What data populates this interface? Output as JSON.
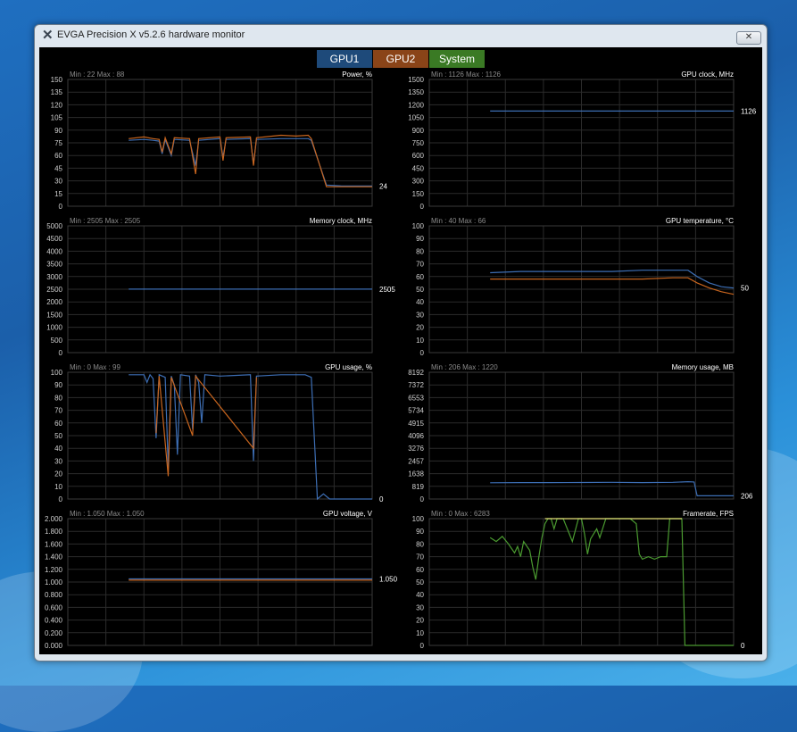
{
  "window": {
    "title": "EVGA Precision X v5.2.6 hardware monitor",
    "close_label": "✕"
  },
  "tabs": [
    {
      "label": "GPU1",
      "color": "#1e4a7a"
    },
    {
      "label": "GPU2",
      "color": "#8a4418"
    },
    {
      "label": "System",
      "color": "#3a7a24"
    }
  ],
  "colors": {
    "gpu1_line": "#3d6eb4",
    "gpu2_line": "#c8651e",
    "system_line": "#e6e07a",
    "system_line_low": "#4a9a30",
    "grid": "#2b2b2b"
  },
  "chart_data": [
    {
      "type": "line",
      "title": "Power, %",
      "minmax": "Min : 22   Max : 88",
      "yticks": [
        "150",
        "135",
        "120",
        "105",
        "90",
        "75",
        "60",
        "45",
        "30",
        "15",
        "0"
      ],
      "ylim": [
        0,
        150
      ],
      "current": "24",
      "series": [
        {
          "color": "#3d6eb4",
          "points": [
            [
              0.2,
              78
            ],
            [
              0.25,
              79
            ],
            [
              0.28,
              78
            ],
            [
              0.3,
              77
            ],
            [
              0.31,
              62
            ],
            [
              0.32,
              79
            ],
            [
              0.34,
              60
            ],
            [
              0.35,
              79
            ],
            [
              0.4,
              78
            ],
            [
              0.42,
              48
            ],
            [
              0.43,
              78
            ],
            [
              0.5,
              80
            ],
            [
              0.51,
              58
            ],
            [
              0.52,
              79
            ],
            [
              0.6,
              80
            ],
            [
              0.61,
              50
            ],
            [
              0.62,
              79
            ],
            [
              0.7,
              80
            ],
            [
              0.75,
              80
            ],
            [
              0.79,
              80
            ],
            [
              0.8,
              78
            ],
            [
              0.85,
              25
            ],
            [
              0.9,
              24
            ],
            [
              1.0,
              24
            ]
          ]
        },
        {
          "color": "#c8651e",
          "points": [
            [
              0.2,
              80
            ],
            [
              0.25,
              82
            ],
            [
              0.28,
              80
            ],
            [
              0.3,
              79
            ],
            [
              0.31,
              64
            ],
            [
              0.32,
              81
            ],
            [
              0.34,
              62
            ],
            [
              0.35,
              81
            ],
            [
              0.4,
              80
            ],
            [
              0.42,
              38
            ],
            [
              0.43,
              80
            ],
            [
              0.5,
              82
            ],
            [
              0.51,
              54
            ],
            [
              0.52,
              81
            ],
            [
              0.6,
              82
            ],
            [
              0.61,
              48
            ],
            [
              0.62,
              81
            ],
            [
              0.7,
              84
            ],
            [
              0.75,
              83
            ],
            [
              0.79,
              84
            ],
            [
              0.8,
              80
            ],
            [
              0.85,
              23
            ],
            [
              0.9,
              23
            ],
            [
              1.0,
              23
            ]
          ]
        }
      ]
    },
    {
      "type": "line",
      "title": "GPU clock, MHz",
      "minmax": "Min : 1126   Max : 1126",
      "yticks": [
        "1500",
        "1350",
        "1200",
        "1050",
        "900",
        "750",
        "600",
        "450",
        "300",
        "150",
        "0"
      ],
      "ylim": [
        0,
        1500
      ],
      "current": "1126",
      "series": [
        {
          "color": "#3d6eb4",
          "points": [
            [
              0.2,
              1126
            ],
            [
              1.0,
              1126
            ]
          ]
        }
      ]
    },
    {
      "type": "line",
      "title": "Memory clock, MHz",
      "minmax": "Min : 2505   Max : 2505",
      "yticks": [
        "5000",
        "4500",
        "4000",
        "3500",
        "3000",
        "2500",
        "2000",
        "1500",
        "1000",
        "500",
        "0"
      ],
      "ylim": [
        0,
        5000
      ],
      "current": "2505",
      "series": [
        {
          "color": "#3d6eb4",
          "points": [
            [
              0.2,
              2505
            ],
            [
              1.0,
              2505
            ]
          ]
        }
      ]
    },
    {
      "type": "line",
      "title": "GPU temperature, °C",
      "minmax": "Min : 40   Max : 66",
      "yticks": [
        "100",
        "90",
        "80",
        "70",
        "60",
        "50",
        "40",
        "30",
        "20",
        "10",
        "0"
      ],
      "ylim": [
        0,
        100
      ],
      "current": "50",
      "series": [
        {
          "color": "#3d6eb4",
          "points": [
            [
              0.2,
              63
            ],
            [
              0.3,
              64
            ],
            [
              0.4,
              64
            ],
            [
              0.5,
              64
            ],
            [
              0.6,
              64
            ],
            [
              0.7,
              65
            ],
            [
              0.8,
              65
            ],
            [
              0.85,
              65
            ],
            [
              0.88,
              60
            ],
            [
              0.92,
              55
            ],
            [
              0.96,
              52
            ],
            [
              1.0,
              51
            ]
          ]
        },
        {
          "color": "#c8651e",
          "points": [
            [
              0.2,
              58
            ],
            [
              0.3,
              58
            ],
            [
              0.4,
              58
            ],
            [
              0.5,
              58
            ],
            [
              0.6,
              58
            ],
            [
              0.7,
              58
            ],
            [
              0.8,
              59
            ],
            [
              0.85,
              59
            ],
            [
              0.88,
              55
            ],
            [
              0.92,
              51
            ],
            [
              0.96,
              48
            ],
            [
              1.0,
              46
            ]
          ]
        }
      ]
    },
    {
      "type": "line",
      "title": "GPU usage, %",
      "minmax": "Min : 0   Max : 99",
      "yticks": [
        "100",
        "90",
        "80",
        "70",
        "60",
        "50",
        "40",
        "30",
        "20",
        "10",
        "0"
      ],
      "ylim": [
        0,
        100
      ],
      "current": "0",
      "series": [
        {
          "color": "#3d6eb4",
          "points": [
            [
              0.2,
              98
            ],
            [
              0.25,
              98
            ],
            [
              0.26,
              92
            ],
            [
              0.27,
              98
            ],
            [
              0.28,
              95
            ],
            [
              0.29,
              48
            ],
            [
              0.3,
              98
            ],
            [
              0.32,
              96
            ],
            [
              0.33,
              25
            ],
            [
              0.34,
              97
            ],
            [
              0.35,
              90
            ],
            [
              0.36,
              35
            ],
            [
              0.37,
              98
            ],
            [
              0.4,
              97
            ],
            [
              0.41,
              55
            ],
            [
              0.42,
              98
            ],
            [
              0.43,
              92
            ],
            [
              0.44,
              60
            ],
            [
              0.45,
              98
            ],
            [
              0.5,
              97
            ],
            [
              0.6,
              98
            ],
            [
              0.61,
              30
            ],
            [
              0.62,
              97
            ],
            [
              0.7,
              98
            ],
            [
              0.78,
              98
            ],
            [
              0.8,
              96
            ],
            [
              0.82,
              0
            ],
            [
              0.84,
              4
            ],
            [
              0.86,
              0
            ],
            [
              1.0,
              0
            ]
          ]
        },
        {
          "color": "#c8651e",
          "points": [
            [
              0.29,
              52
            ],
            [
              0.3,
              97
            ],
            [
              0.33,
              18
            ],
            [
              0.34,
              96
            ],
            [
              0.41,
              50
            ],
            [
              0.42,
              97
            ],
            [
              0.61,
              40
            ],
            [
              0.62,
              96
            ]
          ]
        }
      ]
    },
    {
      "type": "line",
      "title": "Memory usage, MB",
      "minmax": "Min : 206   Max : 1220",
      "yticks": [
        "8192",
        "7372",
        "6553",
        "5734",
        "4915",
        "4096",
        "3276",
        "2457",
        "1638",
        "819",
        "0"
      ],
      "ylim": [
        0,
        8192
      ],
      "current": "206",
      "series": [
        {
          "color": "#3d6eb4",
          "points": [
            [
              0.2,
              1050
            ],
            [
              0.3,
              1060
            ],
            [
              0.4,
              1060
            ],
            [
              0.5,
              1070
            ],
            [
              0.6,
              1080
            ],
            [
              0.7,
              1060
            ],
            [
              0.8,
              1080
            ],
            [
              0.85,
              1120
            ],
            [
              0.87,
              1100
            ],
            [
              0.88,
              206
            ],
            [
              1.0,
              206
            ]
          ]
        }
      ]
    },
    {
      "type": "line",
      "title": "GPU voltage, V",
      "minmax": "Min : 1.050   Max : 1.050",
      "yticks": [
        "2.000",
        "1.800",
        "1.600",
        "1.400",
        "1.200",
        "1.000",
        "0.800",
        "0.600",
        "0.400",
        "0.200",
        "0.000"
      ],
      "ylim": [
        0,
        2
      ],
      "current": "1.050",
      "series": [
        {
          "color": "#3d6eb4",
          "points": [
            [
              0.2,
              1.05
            ],
            [
              1.0,
              1.05
            ]
          ]
        },
        {
          "color": "#c8651e",
          "points": [
            [
              0.2,
              1.03
            ],
            [
              1.0,
              1.03
            ]
          ]
        }
      ]
    },
    {
      "type": "line",
      "title": "Framerate, FPS",
      "minmax": "Min : 0   Max : 6283",
      "yticks": [
        "100",
        "90",
        "80",
        "70",
        "60",
        "50",
        "40",
        "30",
        "20",
        "10",
        "0"
      ],
      "ylim": [
        0,
        100
      ],
      "current": "0",
      "series": [
        {
          "color": "#4a9a30",
          "points": [
            [
              0.2,
              85
            ],
            [
              0.22,
              82
            ],
            [
              0.24,
              86
            ],
            [
              0.26,
              80
            ],
            [
              0.28,
              73
            ],
            [
              0.29,
              78
            ],
            [
              0.3,
              70
            ],
            [
              0.31,
              82
            ],
            [
              0.33,
              75
            ],
            [
              0.34,
              62
            ],
            [
              0.35,
              52
            ],
            [
              0.36,
              70
            ],
            [
              0.37,
              85
            ],
            [
              0.38,
              96
            ],
            [
              0.39,
              100
            ],
            [
              0.4,
              100
            ],
            [
              0.41,
              92
            ],
            [
              0.42,
              100
            ],
            [
              0.44,
              100
            ],
            [
              0.46,
              88
            ],
            [
              0.47,
              82
            ],
            [
              0.49,
              100
            ],
            [
              0.5,
              100
            ],
            [
              0.51,
              88
            ],
            [
              0.52,
              72
            ],
            [
              0.53,
              84
            ],
            [
              0.55,
              92
            ],
            [
              0.56,
              85
            ],
            [
              0.58,
              100
            ],
            [
              0.6,
              100
            ],
            [
              0.62,
              100
            ],
            [
              0.64,
              100
            ],
            [
              0.66,
              100
            ],
            [
              0.68,
              96
            ],
            [
              0.69,
              72
            ],
            [
              0.7,
              68
            ],
            [
              0.72,
              70
            ],
            [
              0.74,
              68
            ],
            [
              0.76,
              70
            ],
            [
              0.78,
              70
            ],
            [
              0.79,
              100
            ],
            [
              0.8,
              100
            ],
            [
              0.82,
              100
            ],
            [
              0.83,
              100
            ],
            [
              0.84,
              0
            ],
            [
              0.9,
              0
            ],
            [
              1.0,
              0
            ]
          ]
        },
        {
          "color": "#e6e07a",
          "points": [
            [
              0.38,
              100
            ],
            [
              0.4,
              100
            ],
            [
              0.42,
              100
            ],
            [
              0.44,
              100
            ],
            [
              0.49,
              100
            ],
            [
              0.5,
              100
            ],
            [
              0.58,
              100
            ],
            [
              0.6,
              100
            ],
            [
              0.62,
              100
            ],
            [
              0.64,
              100
            ],
            [
              0.66,
              100
            ],
            [
              0.79,
              100
            ],
            [
              0.8,
              100
            ],
            [
              0.82,
              100
            ],
            [
              0.83,
              100
            ]
          ]
        }
      ]
    }
  ]
}
